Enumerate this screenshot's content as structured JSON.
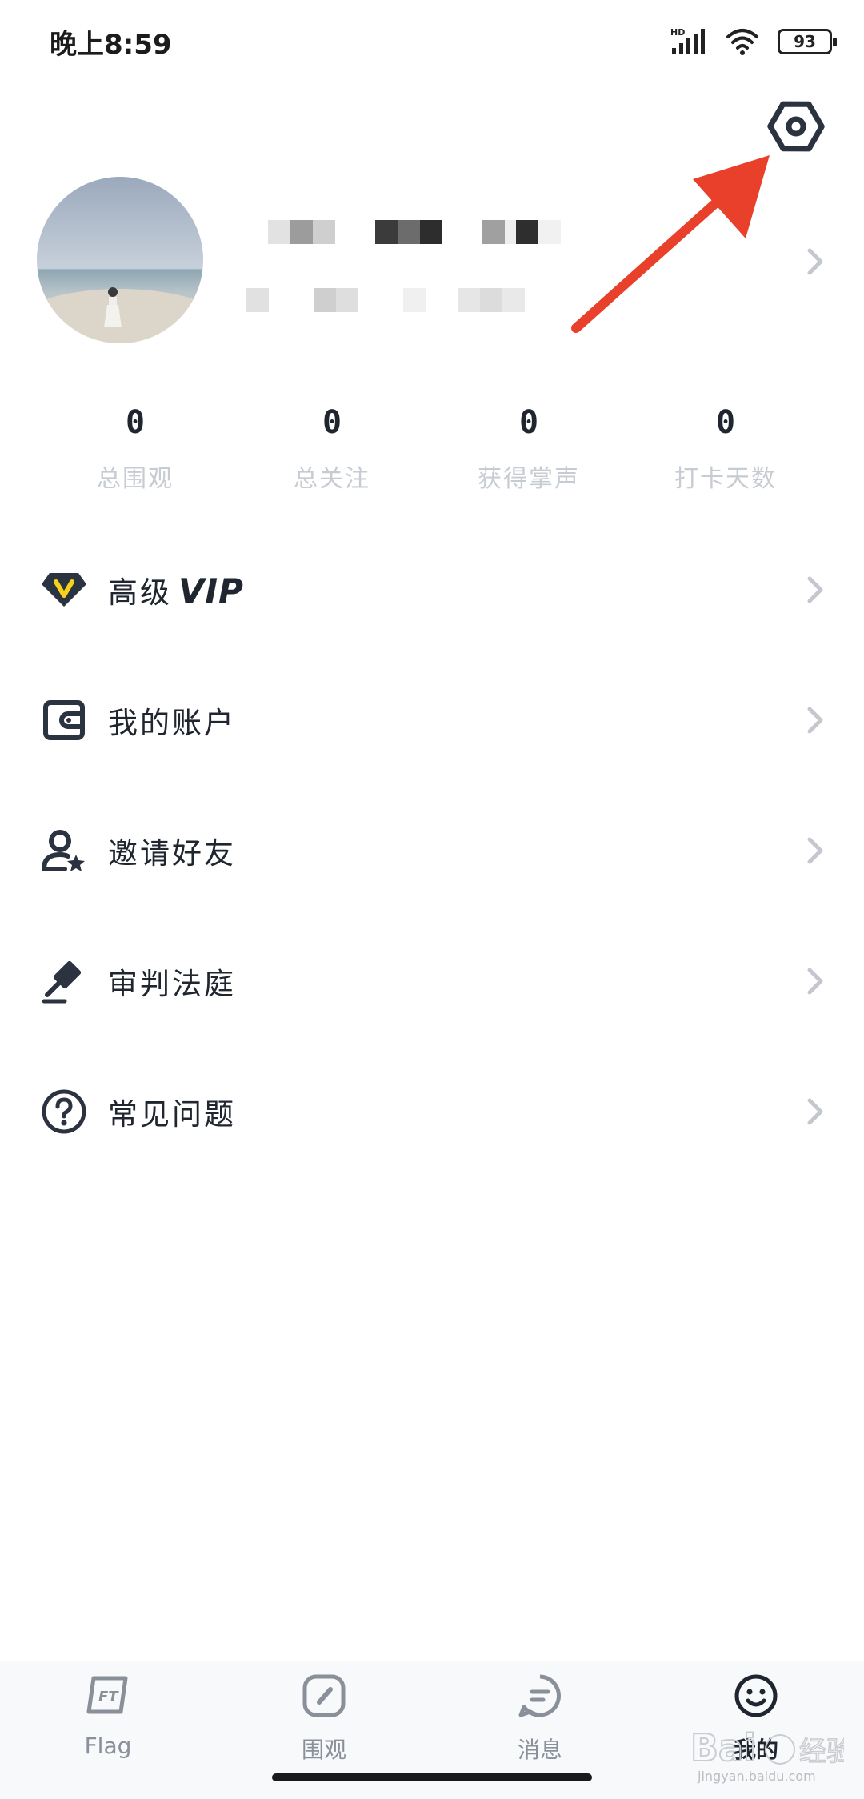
{
  "status_bar": {
    "time": "晚上8:59",
    "battery": "93",
    "network": "HD"
  },
  "header": {
    "settings_icon": "gear-icon"
  },
  "profile": {
    "avatar_icon": "avatar-photo",
    "name_masked": true,
    "id_masked": true
  },
  "stats": [
    {
      "value": "0",
      "label": "总围观"
    },
    {
      "value": "0",
      "label": "总关注"
    },
    {
      "value": "0",
      "label": "获得掌声"
    },
    {
      "value": "0",
      "label": "打卡天数"
    }
  ],
  "menu": {
    "vip": {
      "label": "高级",
      "mark": "VIP",
      "icon": "vip-diamond-icon"
    },
    "account": {
      "label": "我的账户",
      "icon": "wallet-icon"
    },
    "invite": {
      "label": "邀请好友",
      "icon": "user-star-icon"
    },
    "court": {
      "label": "审判法庭",
      "icon": "gavel-icon"
    },
    "faq": {
      "label": "常见问题",
      "icon": "question-icon"
    }
  },
  "bottom_nav": [
    {
      "label": "Flag",
      "icon": "flag-icon"
    },
    {
      "label": "围观",
      "icon": "compass-icon"
    },
    {
      "label": "消息",
      "icon": "message-icon"
    },
    {
      "label": "我的",
      "icon": "smiley-icon",
      "active": true
    }
  ],
  "watermark": {
    "url": "jingyan.baidu.com"
  },
  "colors": {
    "accent_arrow": "#e8402a",
    "vip_badge": "#f5d31c",
    "text": "#20262f",
    "muted": "#c7ccd3"
  }
}
